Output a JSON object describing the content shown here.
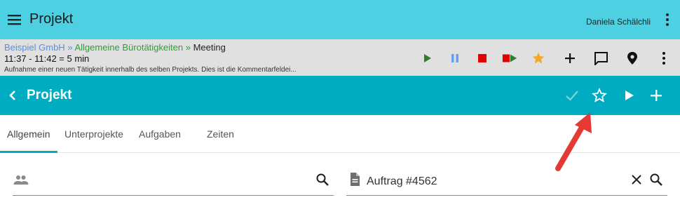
{
  "app": {
    "title": "Projekt",
    "user": "Daniela Schälchli"
  },
  "tracker": {
    "breadcrumb": {
      "company": "Beispiel GmbH",
      "sep1": " » ",
      "project": "Allgemeine Bürotätigkeiten",
      "sep2": " » ",
      "activity": "Meeting"
    },
    "time": "11:37 -  11:42  = 5 min",
    "comment": "Aufnahme einer neuen Tätigkeit innerhalb des selben Projekts. Dies ist die Kommentarfeldei...",
    "colors": {
      "play": "#2e7d32",
      "pause": "#64a0f0",
      "stop": "#e00000",
      "stop_play_red": "#e00000",
      "stop_play_green": "#2e7d32",
      "star": "#f5a623"
    }
  },
  "page": {
    "title": "Projekt"
  },
  "tabs": [
    {
      "label": "Allgemein"
    },
    {
      "label": "Unterprojekte"
    },
    {
      "label": "Aufgaben"
    },
    {
      "label": "Zeiten"
    }
  ],
  "fields": {
    "customer": {
      "value": ""
    },
    "order": {
      "value": "Auftrag #4562"
    }
  },
  "icons": [
    "menu-icon",
    "more-vert-icon",
    "play-icon",
    "pause-icon",
    "stop-icon",
    "stop-and-play-icon",
    "star-icon",
    "add-icon",
    "comment-icon",
    "location-icon",
    "back-icon",
    "check-icon",
    "star-outline-icon",
    "search-icon",
    "people-icon",
    "document-icon",
    "clear-icon"
  ]
}
